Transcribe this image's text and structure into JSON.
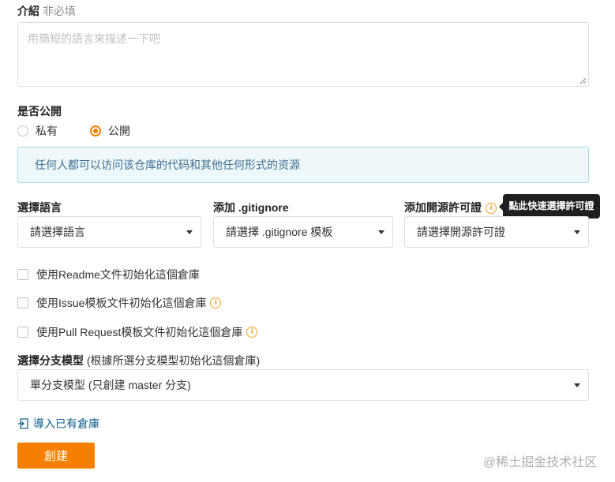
{
  "intro": {
    "label": "介紹",
    "optional": "非必填",
    "placeholder": "用簡短的語言來描述一下吧"
  },
  "visibility": {
    "label": "是否公開",
    "options": [
      {
        "label": "私有",
        "selected": false
      },
      {
        "label": "公開",
        "selected": true
      }
    ],
    "info": "任何人都可以访问该仓库的代码和其他任何形式的资源"
  },
  "selects": {
    "language": {
      "label": "選擇語言",
      "value": "請選擇語言"
    },
    "gitignore": {
      "label": "添加 .gitignore",
      "value": "請選擇 .gitignore 模板"
    },
    "license": {
      "label": "添加開源許可證",
      "value": "請選擇開源許可證",
      "tooltip": "點此快速選擇許可證"
    }
  },
  "init_options": [
    {
      "label": "使用Readme文件初始化這個倉庫",
      "info": false
    },
    {
      "label": "使用Issue模板文件初始化這個倉庫",
      "info": true
    },
    {
      "label": "使用Pull Request模板文件初始化這個倉庫",
      "info": true
    }
  ],
  "branch": {
    "label": "選擇分支模型",
    "hint": "(根據所選分支模型初始化這個倉庫)",
    "value": "單分支模型 (只創建 master 分支)"
  },
  "import_link": "導入已有倉庫",
  "create_button": "創建",
  "watermark": "@稀土掘金技术社区",
  "colors": {
    "accent": "#f77f00",
    "info_bg": "#eef8fb",
    "info_border": "#abd8e5",
    "link": "#0a5c8a"
  }
}
